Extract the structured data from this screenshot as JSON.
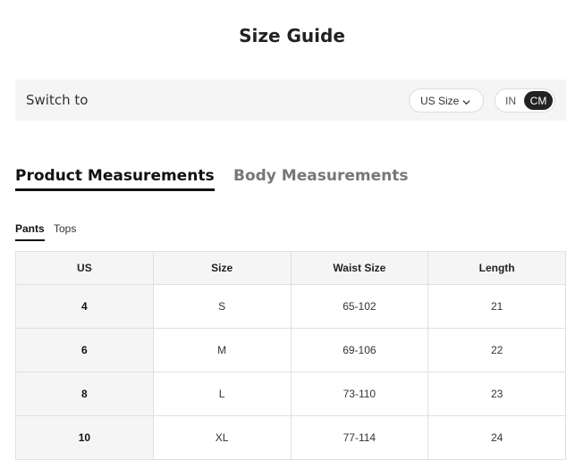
{
  "page": {
    "title": "Size Guide"
  },
  "switch_bar": {
    "label": "Switch to",
    "size_select": "US Size",
    "units": {
      "in": "IN",
      "cm": "CM",
      "active": "CM"
    }
  },
  "tabs": {
    "main": [
      {
        "label": "Product Measurements",
        "active": true
      },
      {
        "label": "Body Measurements",
        "active": false
      }
    ],
    "sub": [
      {
        "label": "Pants",
        "active": true
      },
      {
        "label": "Tops",
        "active": false
      }
    ]
  },
  "table": {
    "headers": [
      "US",
      "Size",
      "Waist Size",
      "Length"
    ],
    "rows": [
      [
        "4",
        "S",
        "65-102",
        "21"
      ],
      [
        "6",
        "M",
        "69-106",
        "22"
      ],
      [
        "8",
        "L",
        "73-110",
        "23"
      ],
      [
        "10",
        "XL",
        "77-114",
        "24"
      ]
    ]
  },
  "icons": {
    "size_select_chevron": "chevron-down-icon"
  }
}
